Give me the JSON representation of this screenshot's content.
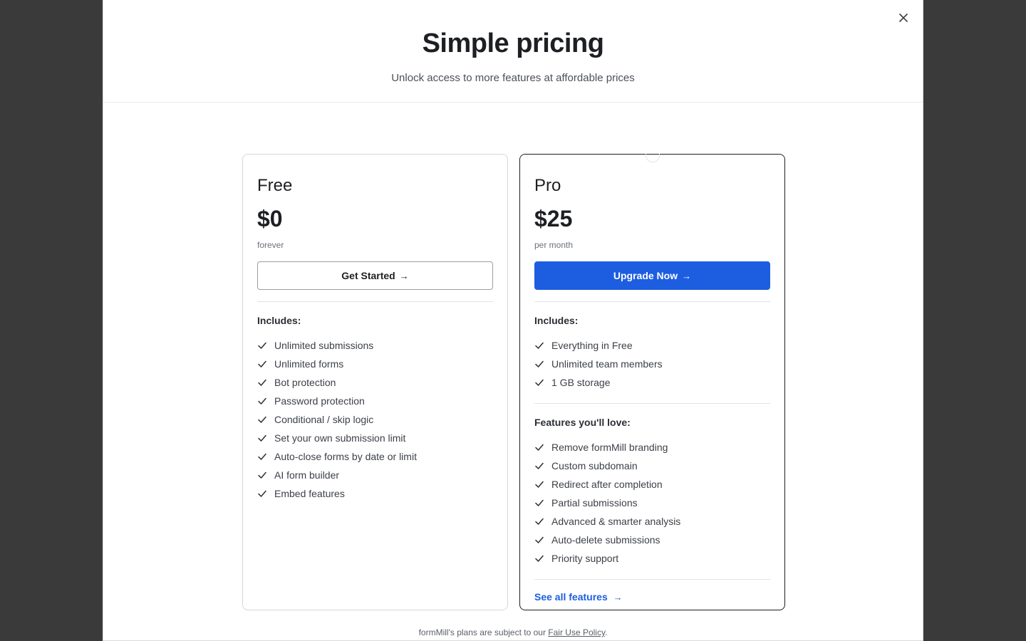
{
  "header": {
    "title": "Simple pricing",
    "subtitle": "Unlock access to more features at affordable prices"
  },
  "plans": {
    "free": {
      "name": "Free",
      "price": "$0",
      "period": "forever",
      "button_label": "Get Started",
      "includes_title": "Includes:",
      "features": [
        "Unlimited submissions",
        "Unlimited forms",
        "Bot protection",
        "Password protection",
        "Conditional / skip logic",
        "Set your own submission limit",
        "Auto-close forms by date or limit",
        "AI form builder",
        "Embed features"
      ]
    },
    "pro": {
      "name": "Pro",
      "price": "$25",
      "period": "per month",
      "button_label": "Upgrade Now",
      "includes_title": "Includes:",
      "includes": [
        "Everything in Free",
        "Unlimited team members",
        "1 GB storage"
      ],
      "love_title": "Features you'll love:",
      "love_features": [
        "Remove formMill branding",
        "Custom subdomain",
        "Redirect after completion",
        "Partial submissions",
        "Advanced & smarter analysis",
        "Auto-delete submissions",
        "Priority support"
      ],
      "see_all_label": "See all features"
    }
  },
  "footer": {
    "prefix": "formMill's plans are subject to our ",
    "link_label": "Fair Use Policy",
    "suffix": "."
  },
  "arrow": "→",
  "colors": {
    "accent": "#1d5ee0",
    "backdrop": "#3a3a3a"
  },
  "icons": {
    "close": "close-icon",
    "check": "check-icon"
  }
}
